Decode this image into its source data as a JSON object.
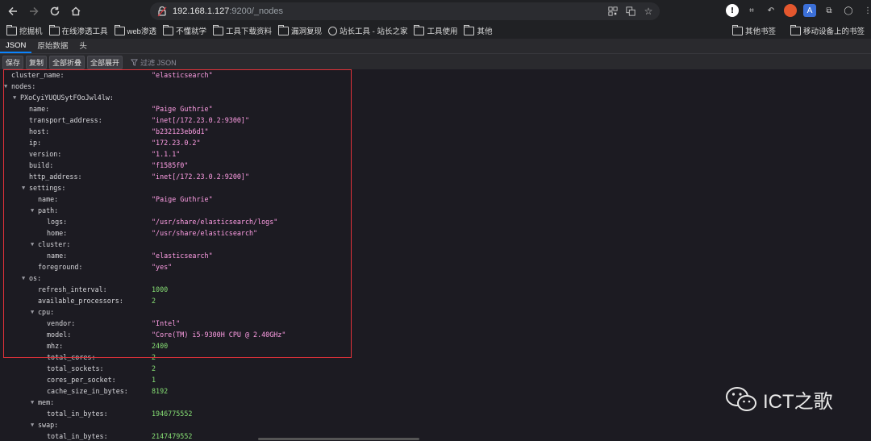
{
  "browser": {
    "url_host": "192.168.1.127",
    "url_path": ":9200/_nodes"
  },
  "bookmarks": {
    "items": [
      "挖掘机",
      "在线渗透工具",
      "web渗透",
      "不懂就学",
      "工具下载资料",
      "漏洞复现",
      "站长工具 - 站长之家",
      "工具使用",
      "其他"
    ],
    "right_items": [
      "其他书签",
      "移动设备上的书签"
    ]
  },
  "viewer": {
    "tabs": [
      "JSON",
      "原始数据",
      "头"
    ],
    "actions": [
      "保存",
      "复制",
      "全部折叠",
      "全部展开"
    ],
    "filter_placeholder": "过滤 JSON"
  },
  "json_rows": [
    {
      "key": "cluster_name:",
      "depth": 0,
      "toggle": false,
      "value": "\"elasticsearch\"",
      "kind": "str"
    },
    {
      "key": "nodes:",
      "depth": 0,
      "toggle": true,
      "value": "",
      "kind": ""
    },
    {
      "key": "PXoCyiYUQUSytFOoJwl4lw:",
      "depth": 1,
      "toggle": true,
      "value": "",
      "kind": ""
    },
    {
      "key": "name:",
      "depth": 2,
      "toggle": false,
      "value": "\"Paige Guthrie\"",
      "kind": "str"
    },
    {
      "key": "transport_address:",
      "depth": 2,
      "toggle": false,
      "value": "\"inet[/172.23.0.2:9300]\"",
      "kind": "str"
    },
    {
      "key": "host:",
      "depth": 2,
      "toggle": false,
      "value": "\"b232123eb6d1\"",
      "kind": "str"
    },
    {
      "key": "ip:",
      "depth": 2,
      "toggle": false,
      "value": "\"172.23.0.2\"",
      "kind": "str"
    },
    {
      "key": "version:",
      "depth": 2,
      "toggle": false,
      "value": "\"1.1.1\"",
      "kind": "str"
    },
    {
      "key": "build:",
      "depth": 2,
      "toggle": false,
      "value": "\"f1585f0\"",
      "kind": "str"
    },
    {
      "key": "http_address:",
      "depth": 2,
      "toggle": false,
      "value": "\"inet[/172.23.0.2:9200]\"",
      "kind": "str"
    },
    {
      "key": "settings:",
      "depth": 2,
      "toggle": true,
      "value": "",
      "kind": ""
    },
    {
      "key": "name:",
      "depth": 3,
      "toggle": false,
      "value": "\"Paige Guthrie\"",
      "kind": "str"
    },
    {
      "key": "path:",
      "depth": 3,
      "toggle": true,
      "value": "",
      "kind": ""
    },
    {
      "key": "logs:",
      "depth": 4,
      "toggle": false,
      "value": "\"/usr/share/elasticsearch/logs\"",
      "kind": "str"
    },
    {
      "key": "home:",
      "depth": 4,
      "toggle": false,
      "value": "\"/usr/share/elasticsearch\"",
      "kind": "str"
    },
    {
      "key": "cluster:",
      "depth": 3,
      "toggle": true,
      "value": "",
      "kind": ""
    },
    {
      "key": "name:",
      "depth": 4,
      "toggle": false,
      "value": "\"elasticsearch\"",
      "kind": "str"
    },
    {
      "key": "foreground:",
      "depth": 3,
      "toggle": false,
      "value": "\"yes\"",
      "kind": "str"
    },
    {
      "key": "os:",
      "depth": 2,
      "toggle": true,
      "value": "",
      "kind": ""
    },
    {
      "key": "refresh_interval:",
      "depth": 3,
      "toggle": false,
      "value": "1000",
      "kind": "num"
    },
    {
      "key": "available_processors:",
      "depth": 3,
      "toggle": false,
      "value": "2",
      "kind": "num"
    },
    {
      "key": "cpu:",
      "depth": 3,
      "toggle": true,
      "value": "",
      "kind": ""
    },
    {
      "key": "vendor:",
      "depth": 4,
      "toggle": false,
      "value": "\"Intel\"",
      "kind": "str"
    },
    {
      "key": "model:",
      "depth": 4,
      "toggle": false,
      "value": "\"Core(TM) i5-9300H CPU @ 2.40GHz\"",
      "kind": "str"
    },
    {
      "key": "mhz:",
      "depth": 4,
      "toggle": false,
      "value": "2400",
      "kind": "num"
    },
    {
      "key": "total_cores:",
      "depth": 4,
      "toggle": false,
      "value": "2",
      "kind": "num"
    },
    {
      "key": "total_sockets:",
      "depth": 4,
      "toggle": false,
      "value": "2",
      "kind": "num"
    },
    {
      "key": "cores_per_socket:",
      "depth": 4,
      "toggle": false,
      "value": "1",
      "kind": "num"
    },
    {
      "key": "cache_size_in_bytes:",
      "depth": 4,
      "toggle": false,
      "value": "8192",
      "kind": "num"
    },
    {
      "key": "mem:",
      "depth": 3,
      "toggle": true,
      "value": "",
      "kind": ""
    },
    {
      "key": "total_in_bytes:",
      "depth": 4,
      "toggle": false,
      "value": "1946775552",
      "kind": "num"
    },
    {
      "key": "swap:",
      "depth": 3,
      "toggle": true,
      "value": "",
      "kind": ""
    },
    {
      "key": "total_in_bytes:",
      "depth": 4,
      "toggle": false,
      "value": "2147479552",
      "kind": "num"
    }
  ],
  "watermark": {
    "text": "ICT之歌"
  },
  "colors": {
    "string": "#ff9ee5",
    "number": "#86de74",
    "highlight_box": "#e0323a"
  }
}
